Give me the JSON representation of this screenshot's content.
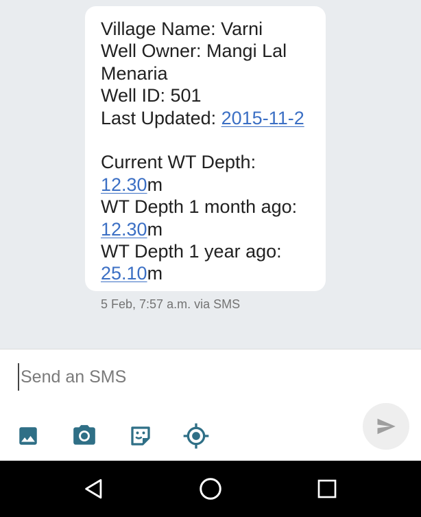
{
  "message": {
    "village_label": "Village Name: Varni",
    "owner_label": "Well Owner: Mangi Lal",
    "owner_cont": "Menaria",
    "well_id_label": "Well ID: 501",
    "last_updated_label": "Last Updated: ",
    "last_updated_value": "2015-11-2",
    "current_label": "Current WT Depth:",
    "current_value": "12.30",
    "month_label": "WT Depth 1 month ago:",
    "month_value": "12.30",
    "year_label": "WT Depth 1 year ago:",
    "year_value": "25.10",
    "unit": "m"
  },
  "timestamp": "5 Feb, 7:57 a.m. via SMS",
  "composer": {
    "placeholder": "Send an SMS",
    "value": ""
  },
  "icons": {
    "attach_image": "image-icon",
    "camera": "camera-icon",
    "sticker": "sticker-icon",
    "location": "location-icon",
    "send": "send-icon",
    "nav_back": "back-icon",
    "nav_home": "home-icon",
    "nav_recents": "recents-icon"
  },
  "colors": {
    "link": "#3b6fc4",
    "icon": "#2f6f86",
    "background": "#e9ecef",
    "bubble": "#ffffff"
  }
}
